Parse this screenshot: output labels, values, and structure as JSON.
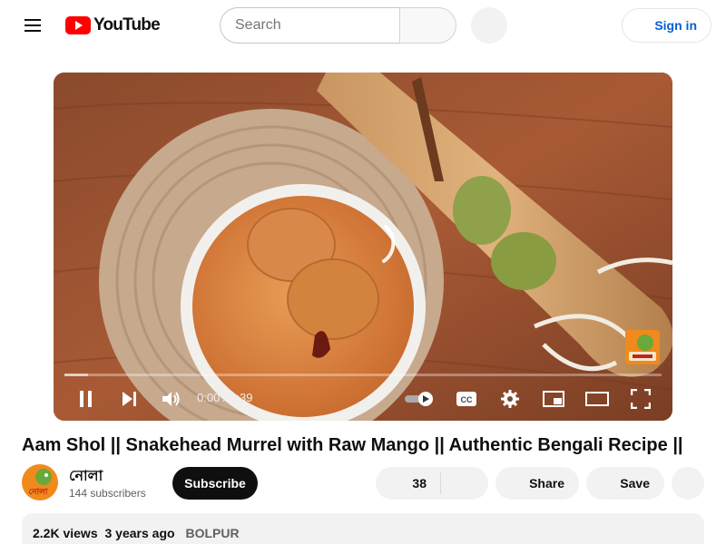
{
  "header": {
    "brand": "YouTube",
    "search_placeholder": "Search",
    "signin_label": "Sign in"
  },
  "player": {
    "time_current": "0:00",
    "time_separator": " / ",
    "time_total": "5:39",
    "progress_loaded": 0.04
  },
  "video": {
    "title": "Aam Shol || Snakehead Murrel with Raw Mango || Authentic Bengali Recipe ||"
  },
  "channel": {
    "name": "নোলা",
    "subscribers": "144 subscribers",
    "subscribe_label": "Subscribe",
    "avatar_text": "নোলা"
  },
  "actions": {
    "like_count": "38",
    "share_label": "Share",
    "save_label": "Save"
  },
  "description": {
    "views": "2.2K views",
    "age": "3 years ago",
    "location": "BOLPUR"
  }
}
